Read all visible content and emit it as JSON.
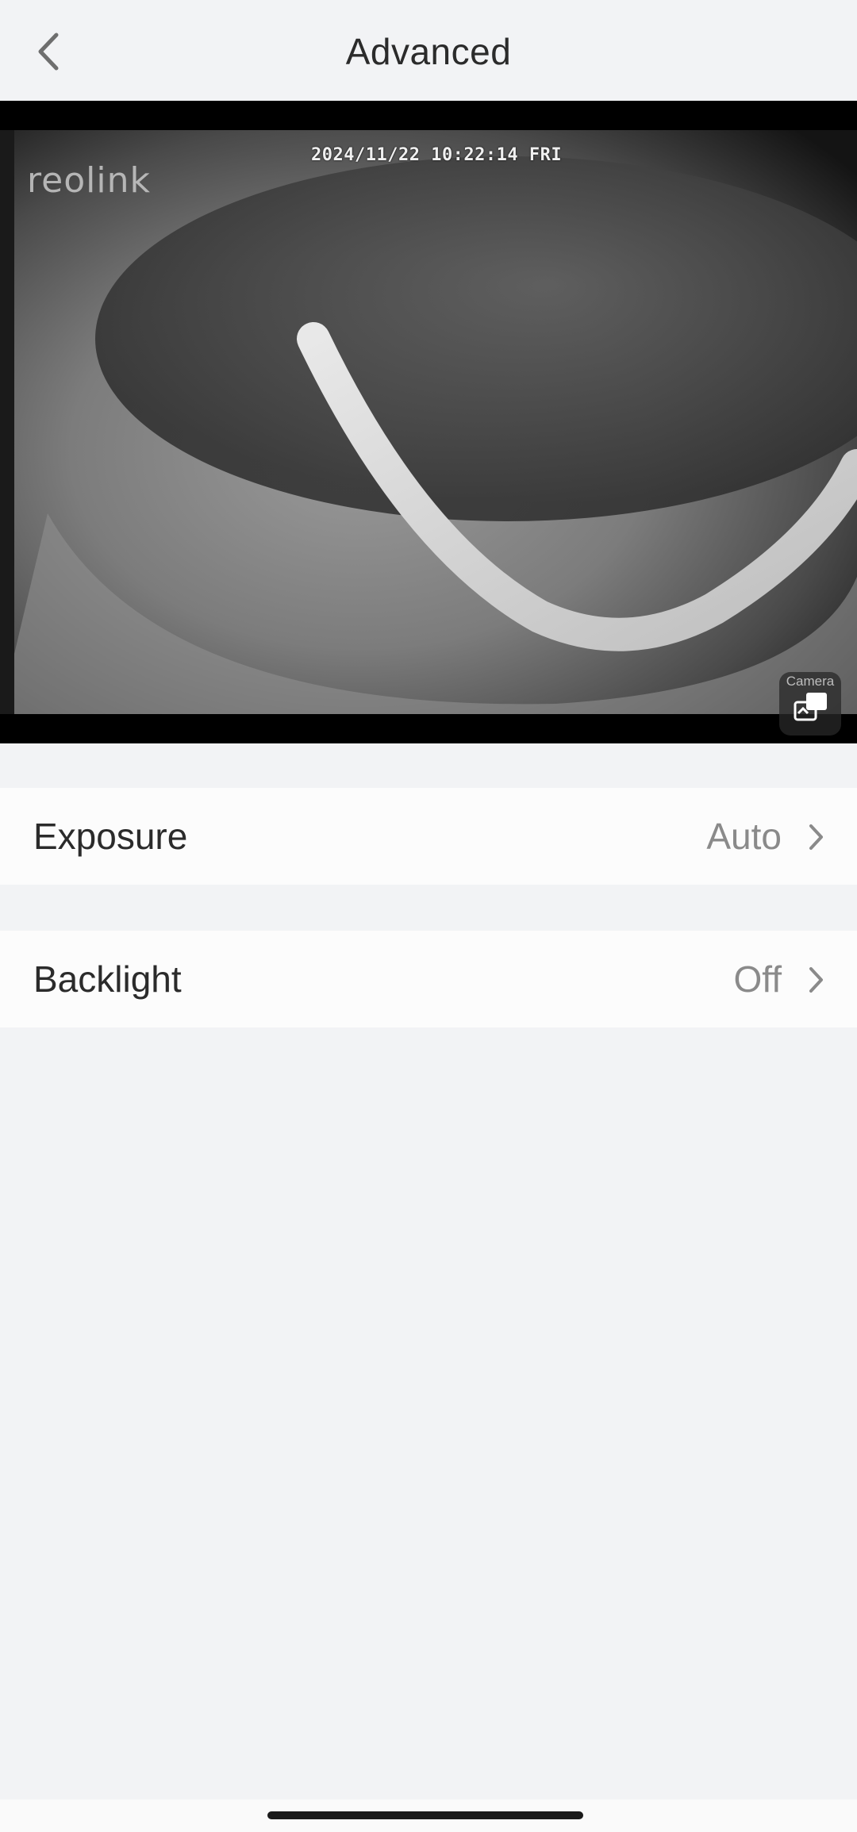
{
  "header": {
    "title": "Advanced",
    "back_icon": "chevron-left-icon"
  },
  "camera_view": {
    "timestamp": "2024/11/22 10:22:14 FRI",
    "logo": "reolink",
    "switch_label": "Camera",
    "switch_icon": "camera-switch-icon"
  },
  "settings": [
    {
      "label": "Exposure",
      "value": "Auto",
      "icon": "chevron-right-icon"
    },
    {
      "label": "Backlight",
      "value": "Off",
      "icon": "chevron-right-icon"
    }
  ],
  "colors": {
    "background": "#f2f3f5",
    "row_background": "#fcfcfc",
    "text_primary": "#2b2b2b",
    "text_secondary": "#8a8a8a"
  }
}
